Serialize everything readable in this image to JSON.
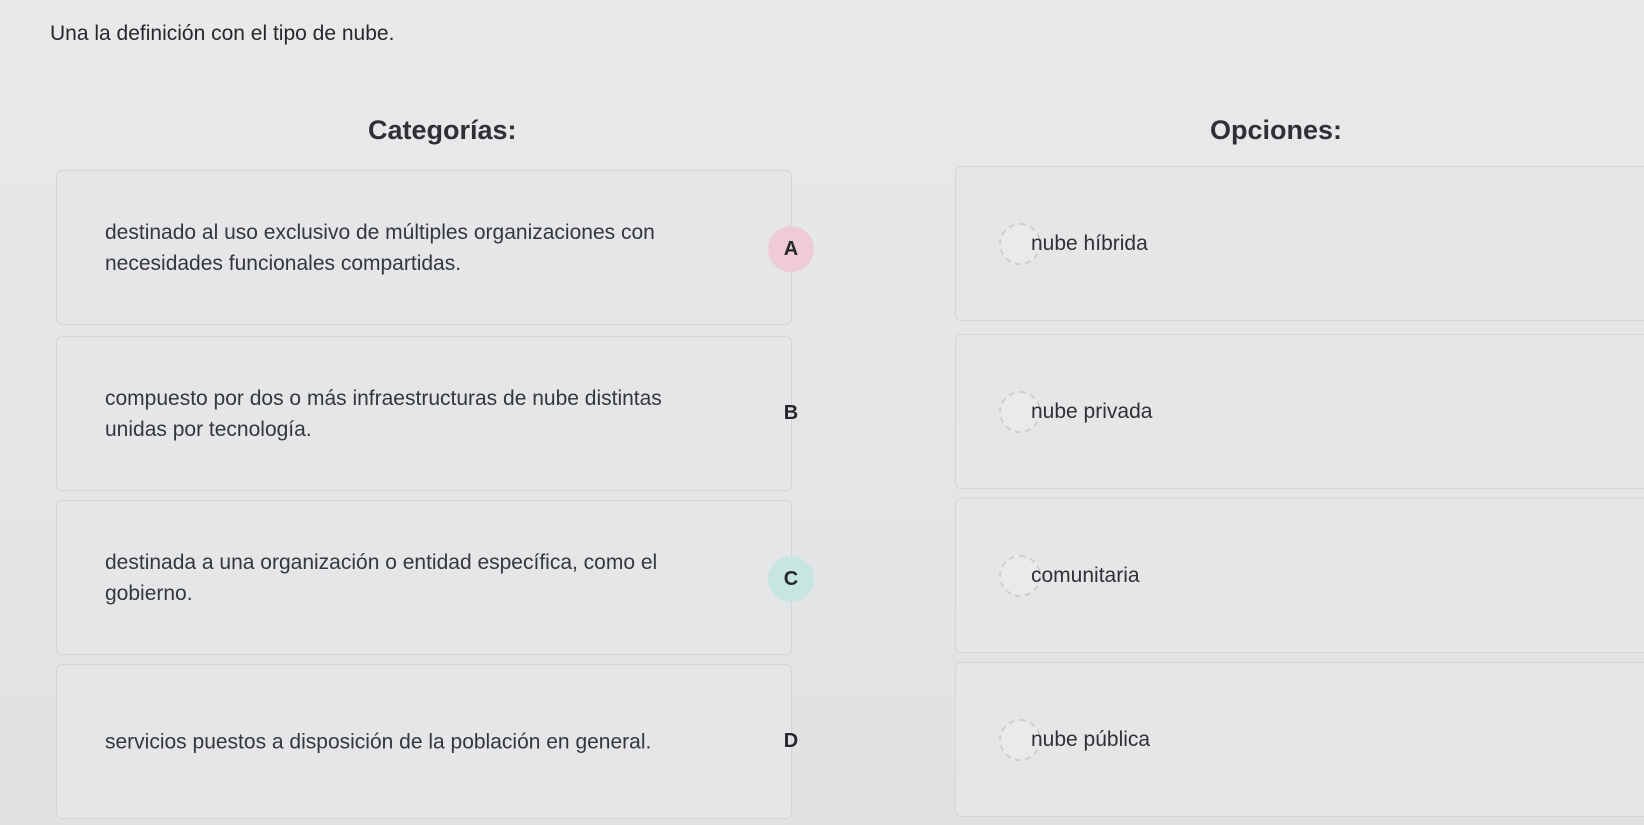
{
  "instruction": "Una la definición con el tipo de nube.",
  "categories_heading": "Categorías:",
  "options_heading": "Opciones:",
  "categories": [
    {
      "text": "destinado al uso exclusivo de múltiples organizaciones con necesidades funcionales compartidas.",
      "letter": "A",
      "badge_color": "#efcbd7"
    },
    {
      "text": "compuesto por dos o más infraestructuras de nube distintas unidas por tecnología.",
      "letter": "B",
      "badge_color": "transparent"
    },
    {
      "text": "destinada a una organización o entidad específica, como el gobierno.",
      "letter": "C",
      "badge_color": "#c7e6e1"
    },
    {
      "text": "servicios puestos a disposición de la población en general.",
      "letter": "D",
      "badge_color": "transparent"
    }
  ],
  "options": [
    {
      "label": "nube híbrida"
    },
    {
      "label": "nube privada"
    },
    {
      "label": "comunitaria"
    },
    {
      "label": "nube pública"
    }
  ]
}
